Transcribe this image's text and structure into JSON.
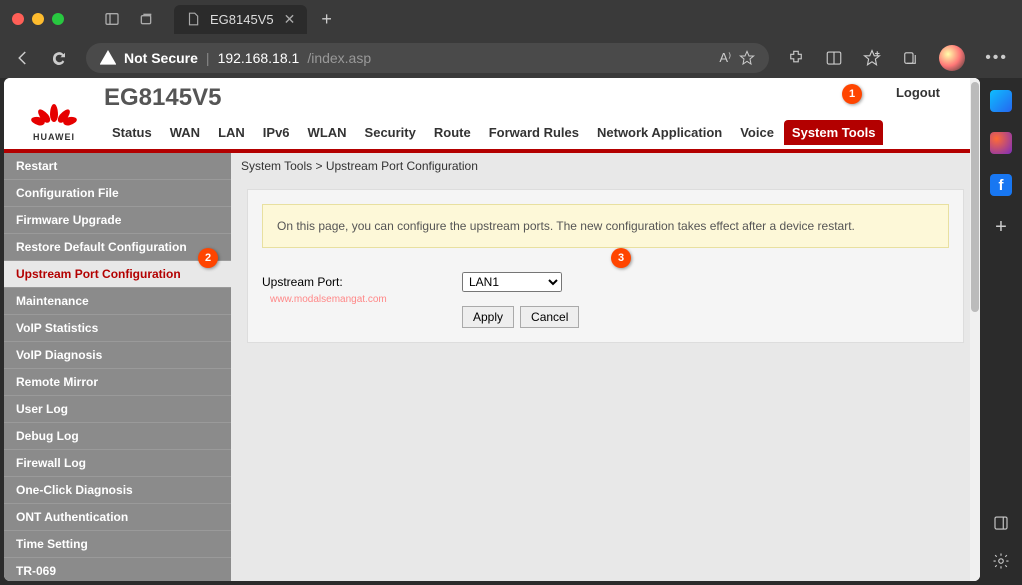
{
  "browser": {
    "tab_title": "EG8145V5",
    "not_secure": "Not Secure",
    "host": "192.168.18.1",
    "path": "/index.asp"
  },
  "header": {
    "logo_text": "HUAWEI",
    "product": "EG8145V5",
    "logout": "Logout",
    "tabs": [
      "Status",
      "WAN",
      "LAN",
      "IPv6",
      "WLAN",
      "Security",
      "Route",
      "Forward Rules",
      "Network Application",
      "Voice",
      "System Tools"
    ],
    "active_tab": "System Tools"
  },
  "sidebar": {
    "items": [
      "Restart",
      "Configuration File",
      "Firmware Upgrade",
      "Restore Default Configuration",
      "Upstream Port Configuration",
      "Maintenance",
      "VoIP Statistics",
      "VoIP Diagnosis",
      "Remote Mirror",
      "User Log",
      "Debug Log",
      "Firewall Log",
      "One-Click Diagnosis",
      "ONT Authentication",
      "Time Setting",
      "TR-069"
    ],
    "active_index": 4
  },
  "main": {
    "breadcrumb": "System Tools > Upstream Port Configuration",
    "info": "On this page, you can configure the upstream ports. The new configuration takes effect after a device restart.",
    "form_label": "Upstream Port:",
    "select_value": "LAN1",
    "apply": "Apply",
    "cancel": "Cancel",
    "watermark": "www.modalsemangat.com"
  },
  "badges": {
    "b1": "1",
    "b2": "2",
    "b3": "3"
  },
  "fb": "f"
}
